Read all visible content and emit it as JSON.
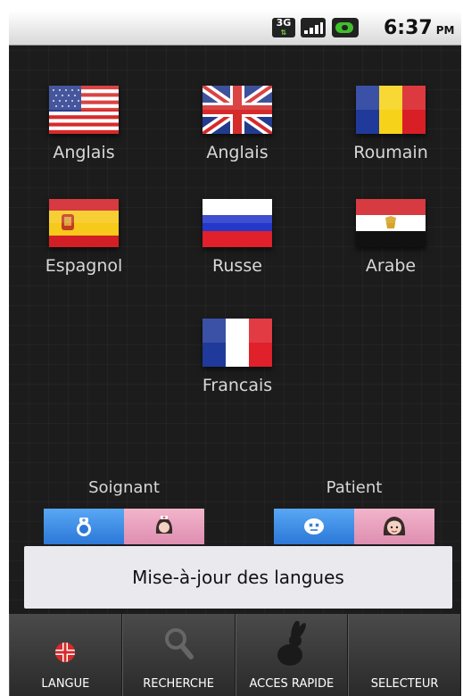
{
  "status_bar": {
    "network": "3G",
    "time": "6:37",
    "ampm": "PM",
    "battery_color": "#3fbf2b"
  },
  "languages": [
    {
      "label": "Anglais",
      "flag": "us-flag-icon"
    },
    {
      "label": "Anglais",
      "flag": "uk-flag-icon"
    },
    {
      "label": "Roumain",
      "flag": "romania-flag-icon"
    },
    {
      "label": "Espagnol",
      "flag": "spain-flag-icon"
    },
    {
      "label": "Russe",
      "flag": "russia-flag-icon"
    },
    {
      "label": "Arabe",
      "flag": "egypt-flag-icon"
    },
    {
      "label": "Francais",
      "flag": "france-flag-icon"
    }
  ],
  "roles": {
    "caregiver_label": "Soignant",
    "patient_label": "Patient",
    "active_color": "#2b78d8",
    "inactive_color": "#de8eb0"
  },
  "update_button": "Mise-à-jour des langues",
  "tabs": [
    {
      "label": "LANGUE",
      "icon": "uk-flag-round-icon"
    },
    {
      "label": "RECHERCHE",
      "icon": "magnifier-icon"
    },
    {
      "label": "ACCES RAPIDE",
      "icon": "rabbit-icon"
    },
    {
      "label": "SELECTEUR",
      "icon": "selector-icon"
    }
  ]
}
